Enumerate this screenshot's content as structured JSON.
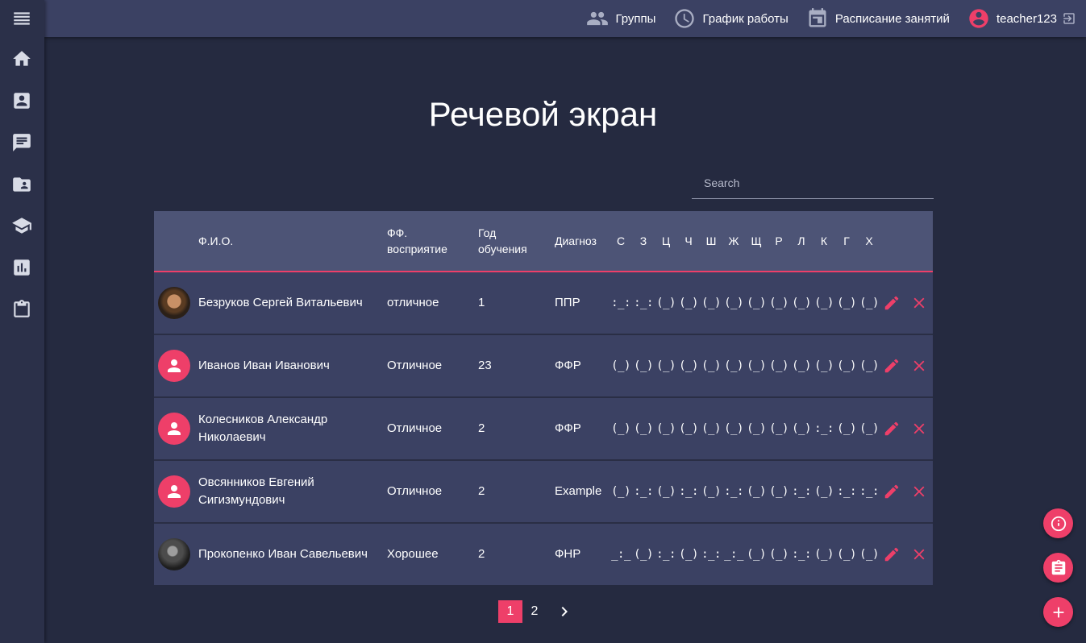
{
  "topnav": {
    "groups_label": "Группы",
    "work_schedule_label": "График работы",
    "class_schedule_label": "Расписание занятий",
    "username": "teacher123"
  },
  "page": {
    "title": "Речевой экран"
  },
  "search": {
    "placeholder": "Search",
    "value": ""
  },
  "table": {
    "headers": {
      "name": "Ф.И.О.",
      "perception": "ФФ. восприятие",
      "year": "Год обучения",
      "diagnosis": "Диагноз",
      "sounds": [
        "С",
        "З",
        "Ц",
        "Ч",
        "Ш",
        "Ж",
        "Щ",
        "Р",
        "Л",
        "К",
        "Г",
        "Х"
      ]
    },
    "rows": [
      {
        "avatar": "photo",
        "name": "Безруков Сергей Витальевич",
        "perception": "отличное",
        "year": "1",
        "diagnosis": "ППР",
        "sounds": [
          ":_:",
          ":_:",
          "(_)",
          "(_)",
          "(_)",
          "(_)",
          "(_)",
          "(_)",
          "(_)",
          "(_)",
          "(_)",
          "(_)"
        ]
      },
      {
        "avatar": "placeholder",
        "name": "Иванов Иван Иванович",
        "perception": "Отличное",
        "year": "23",
        "diagnosis": "ФФР",
        "sounds": [
          "(_)",
          "(_)",
          "(_)",
          "(_)",
          "(_)",
          "(_)",
          "(_)",
          "(_)",
          "(_)",
          "(_)",
          "(_)",
          "(_)"
        ]
      },
      {
        "avatar": "placeholder",
        "name": "Колесников Александр Николаевич",
        "perception": "Отличное",
        "year": "2",
        "diagnosis": "ФФР",
        "sounds": [
          "(_)",
          "(_)",
          "(_)",
          "(_)",
          "(_)",
          "(_)",
          "(_)",
          "(_)",
          "(_)",
          ":_:",
          "(_)",
          "(_)"
        ]
      },
      {
        "avatar": "placeholder",
        "name": "Овсянников Евгений Сигизмундович",
        "perception": "Отличное",
        "year": "2",
        "diagnosis": "Example",
        "sounds": [
          "(_)",
          ":_:",
          "(_)",
          ":_:",
          "(_)",
          ":_:",
          "(_)",
          "(_)",
          ":_:",
          "(_)",
          ":_:",
          ":_:"
        ]
      },
      {
        "avatar": "photo",
        "name": "Прокопенко Иван Савельевич",
        "perception": "Хорошее",
        "year": "2",
        "diagnosis": "ФНР",
        "sounds": [
          "_:_",
          "(_)",
          ":_:",
          "(_)",
          ":_:",
          "_:_",
          "(_)",
          "(_)",
          ":_:",
          "(_)",
          "(_)",
          "(_)"
        ]
      }
    ]
  },
  "pagination": {
    "pages": [
      "1",
      "2"
    ],
    "current": "1"
  },
  "colors": {
    "accent": "#ee3f69",
    "background": "#252a40",
    "sidebar": "#2b3049",
    "topbar": "#3b4163",
    "table_header": "#4d5476",
    "table_row": "#3b4163"
  },
  "icons": {
    "sidebar": [
      "menu-icon",
      "home-icon",
      "contact-card-icon",
      "message-icon",
      "shared-folder-icon",
      "school-icon",
      "bar-chart-icon",
      "clipboard-icon"
    ],
    "fabs": [
      "info-icon",
      "assignment-icon",
      "add-icon"
    ]
  }
}
